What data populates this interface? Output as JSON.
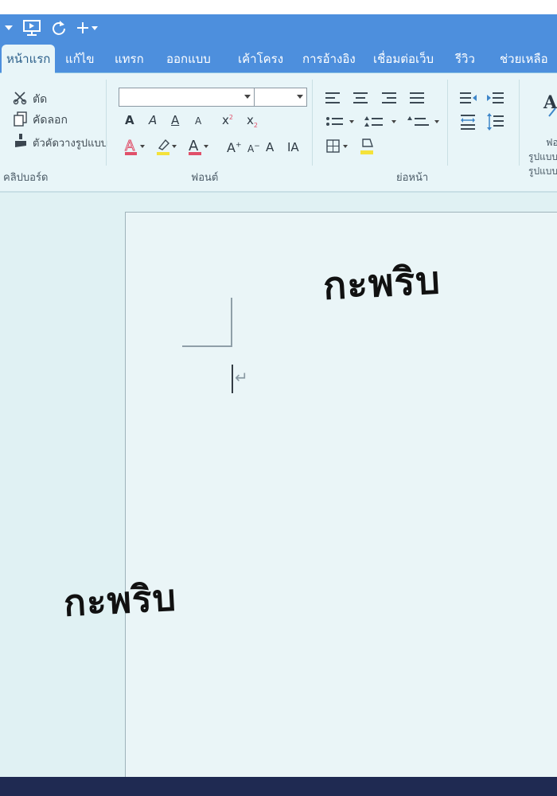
{
  "quick_access": {
    "dropdown_icon": "caret-down-icon",
    "present_icon": "monitor-icon",
    "refresh_icon": "refresh-icon",
    "add_icon": "plus-icon"
  },
  "tabs": [
    {
      "label": "หน้าแรก",
      "active": true
    },
    {
      "label": "แก้ไข"
    },
    {
      "label": "แทรก"
    },
    {
      "label": "ออกแบบ"
    },
    {
      "label": "เค้าโครง"
    },
    {
      "label": "การอ้างอิง"
    },
    {
      "label": "เชื่อมต่อเว็บ"
    },
    {
      "label": "รีวิว"
    },
    {
      "label": "ช่วยเหลือ"
    }
  ],
  "clipboard": {
    "cut_label": "ตัด",
    "copy_label": "คัดลอก",
    "format_painter_label": "ตัวคัดวางรูปแบบ",
    "group_label": "คลิปบอร์ด"
  },
  "font": {
    "name_value": "",
    "size_value": "",
    "group_label": "ฟอนต์"
  },
  "paragraph": {
    "group_label": "ย่อหน้า"
  },
  "styles": {
    "label_line1": "ฟอ",
    "label_line2": "รูปแบบ",
    "label_line3": "รูปแบบ"
  },
  "document": {
    "sfx_top": "กะพริบ",
    "sfx_bottom": "กะพริบ",
    "paragraph_mark": "↵"
  },
  "colors": {
    "titlebar": "#4d8fdd",
    "ribbon": "#e8f5f8",
    "page": "#eaf5f7",
    "highlight_yellow": "#f4e23a",
    "font_red": "#e0506a"
  }
}
